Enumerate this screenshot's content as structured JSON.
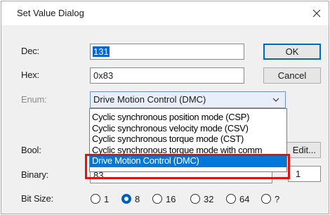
{
  "window": {
    "title": "Set Value Dialog"
  },
  "labels": {
    "dec": "Dec:",
    "hex": "Hex:",
    "enum": "Enum:",
    "bool": "Bool:",
    "binary": "Binary:",
    "bitsize": "Bit Size:"
  },
  "fields": {
    "dec_value": "131",
    "hex_value": "0x83",
    "binary_value": "83",
    "binary_right": "1"
  },
  "buttons": {
    "ok": "OK",
    "cancel": "Cancel",
    "edit": "Edit..."
  },
  "enum_combo": {
    "selected": "Drive Motion Control (DMC)",
    "options": [
      "Cyclic synchronous position mode (CSP)",
      "Cyclic synchronous velocity mode (CSV)",
      "Cyclic synchronous torque mode (CST)",
      "Cyclic synchronous torque mode with comm",
      "Drive Motion Control (DMC)"
    ],
    "highlighted_index": 4
  },
  "bit_size": {
    "options": [
      "1",
      "8",
      "16",
      "32",
      "64",
      "?"
    ],
    "selected": "8"
  },
  "colors": {
    "selection_blue": "#0078d7",
    "highlight_red": "#e01212",
    "radio_accent": "#005fb8"
  }
}
